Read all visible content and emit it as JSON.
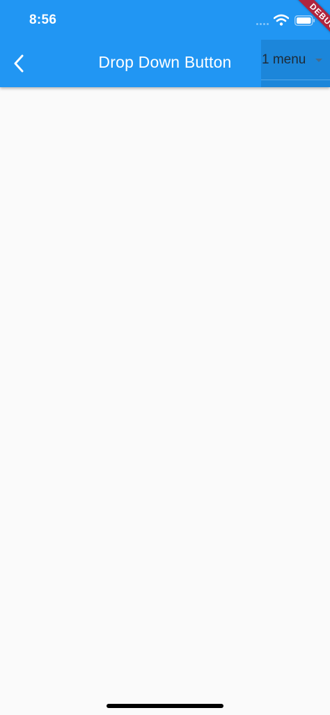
{
  "status_bar": {
    "time": "8:56"
  },
  "app_bar": {
    "title": "Drop Down Button",
    "back_icon": "chevron-left-icon",
    "background": "#2196f3"
  },
  "dropdown": {
    "selected_value": "1 menu",
    "arrow_icon": "arrow-drop-down-icon"
  },
  "debug_banner": {
    "label": "DEBUG",
    "color": "#b0253f"
  },
  "page": {
    "background": "#fafafa"
  }
}
